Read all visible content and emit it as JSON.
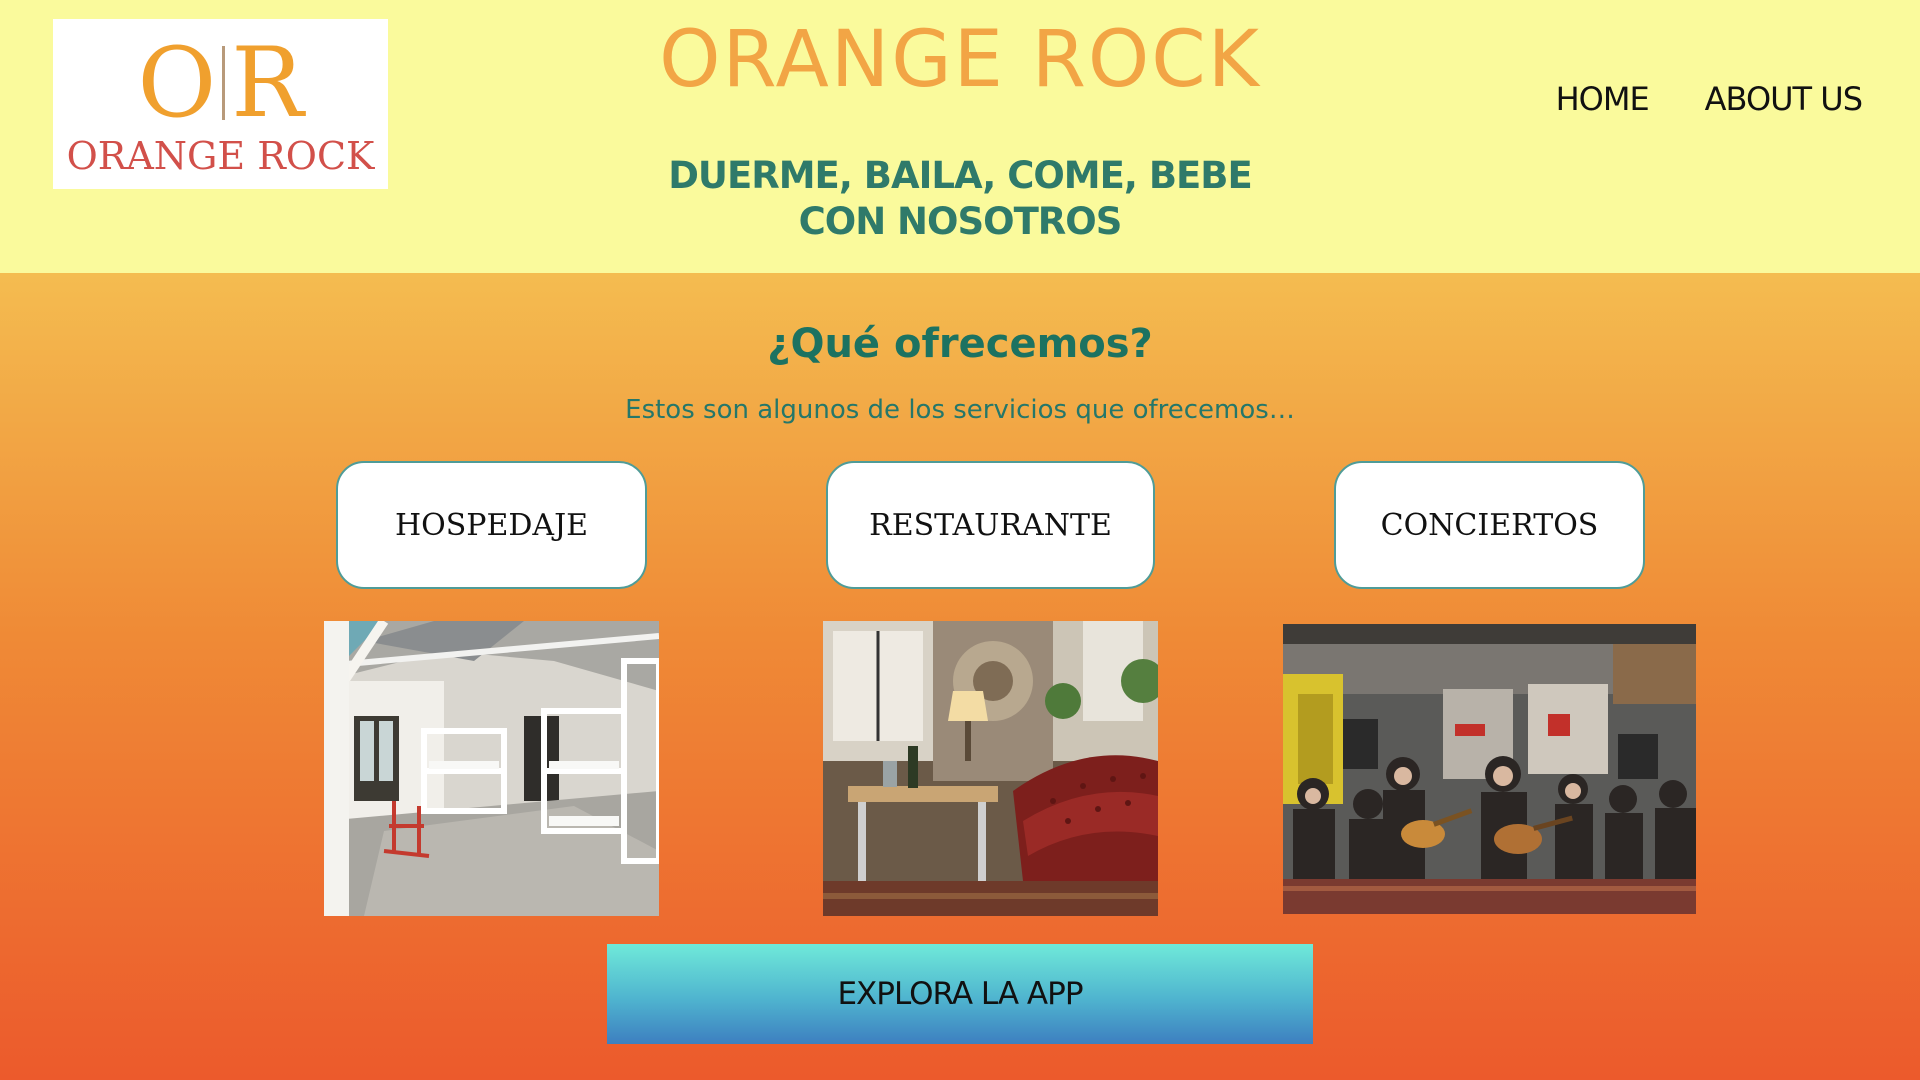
{
  "header": {
    "logo": {
      "mark_left": "O",
      "mark_right": "R",
      "wordmark": "ORANGE ROCK"
    },
    "title": "ORANGE ROCK",
    "tagline_line1": "DUERME, BAILA, COME, BEBE",
    "tagline_line2": "CON NOSOTROS",
    "nav": [
      {
        "label": "HOME"
      },
      {
        "label": "ABOUT US"
      }
    ]
  },
  "main": {
    "section_title": "¿Qué ofrecemos?",
    "section_subtitle": "Estos son algunos de los servicios que ofrecemos…",
    "services": [
      {
        "label": "HOSPEDAJE",
        "image": "hostel-dormitory-bunk-beds"
      },
      {
        "label": "RESTAURANTE",
        "image": "restaurant-interior-leather-sofa"
      },
      {
        "label": "CONCIERTOS",
        "image": "live-concert-band"
      }
    ],
    "cta_label": "EXPLORA LA APP"
  },
  "colors": {
    "header_bg": "#fafa9c",
    "title": "#f2a545",
    "tagline": "#2f7a6a",
    "gradient_top": "#f4bc50",
    "gradient_bottom": "#ec5a2c",
    "cta_top": "#6fe9d9",
    "cta_bottom": "#3d7fc0"
  }
}
